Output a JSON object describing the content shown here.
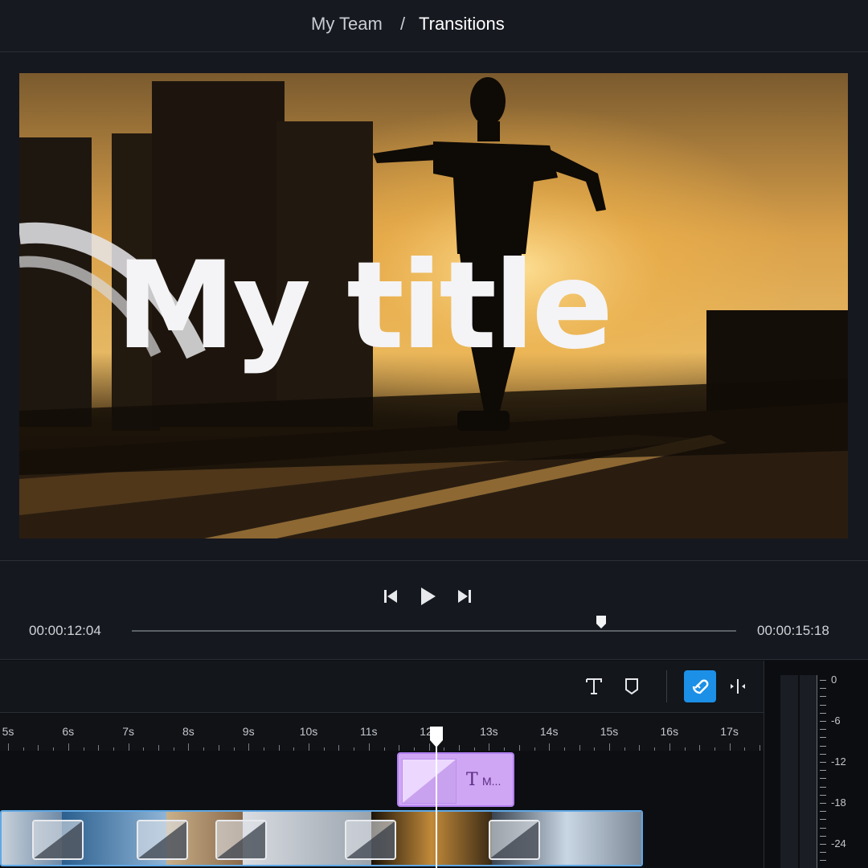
{
  "breadcrumb": {
    "team": "My Team",
    "separator": "/",
    "page": "Transitions"
  },
  "preview": {
    "overlay_title": "My title"
  },
  "transport": {
    "current_time": "00:00:12:04",
    "total_time": "00:00:15:18",
    "progress": 0.77
  },
  "toolbar": {
    "tools": [
      "text-tool",
      "marker-tool",
      "magnet-snap-toggle",
      "split-tool"
    ],
    "snap_active": true
  },
  "ruler": {
    "labels": [
      "5s",
      "6s",
      "7s",
      "8s",
      "9s",
      "10s",
      "11s",
      "12s",
      "13s",
      "14s",
      "15s",
      "16s",
      "17s"
    ]
  },
  "title_clip": {
    "label": "M...",
    "icon": "T"
  },
  "meter": {
    "labels": [
      "0",
      "-6",
      "-12",
      "-18",
      "-24"
    ]
  },
  "colors": {
    "accent": "#1c8fe6",
    "title_clip": "#cfa6f3",
    "video_border": "#5fa8e6"
  }
}
